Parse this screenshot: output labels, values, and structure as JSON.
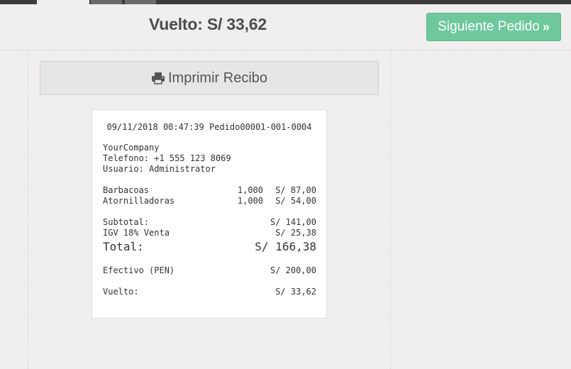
{
  "header": {
    "change_label": "Vuelto: S/ 33,62",
    "next_button_label": "Siguiente Pedido",
    "next_button_icon": "double-chevron-right-icon"
  },
  "actions": {
    "print_button_label": "Imprimir Recibo",
    "print_icon": "printer-icon"
  },
  "colors": {
    "accent_green": "#6ec89b",
    "background": "#f0eeee"
  },
  "receipt": {
    "datetime": "09/11/2018 00:47:39",
    "order_ref": "Pedido00001-001-0004",
    "company": "YourCompany",
    "phone": "Telefono: +1 555 123 8069",
    "user": "Usuario: Administrator",
    "items": [
      {
        "name": "Barbacoas",
        "qty": "1,000",
        "price": "S/ 87,00"
      },
      {
        "name": "Atornilladoras",
        "qty": "1,000",
        "price": "S/ 54,00"
      }
    ],
    "subtotal_label": "Subtotal:",
    "subtotal_value": "S/ 141,00",
    "tax_label": "IGV 18% Venta",
    "tax_value": "S/ 25,38",
    "total_label": "Total:",
    "total_value": "S/ 166,38",
    "payment_label": "Efectivo (PEN)",
    "payment_value": "S/ 200,00",
    "change_label": "Vuelto:",
    "change_value": "S/ 33,62"
  }
}
